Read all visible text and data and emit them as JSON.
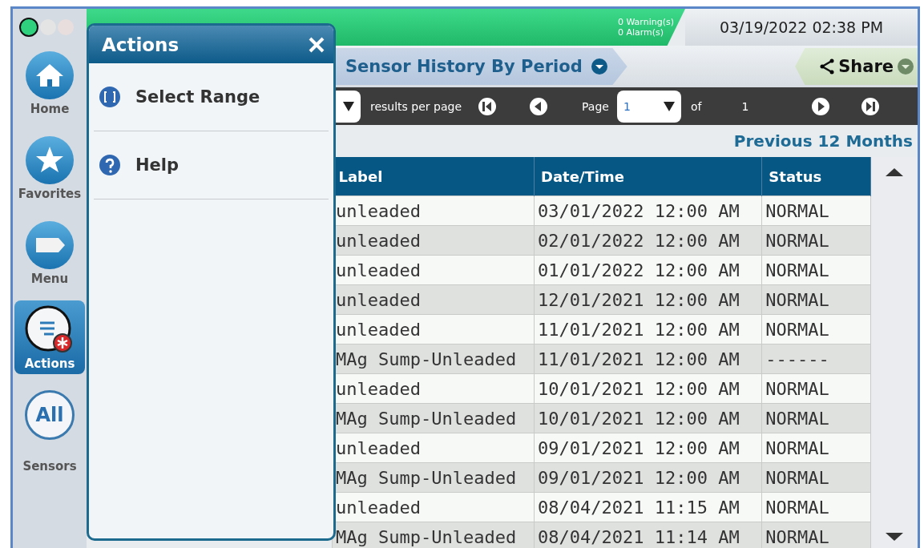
{
  "status_bar": {
    "warnings": "0 Warning(s)",
    "alarms": "0 Alarm(s)",
    "datetime": "03/19/2022 02:38 PM"
  },
  "sidebar": {
    "items": [
      {
        "label": "Home",
        "kind": "home",
        "selected": false
      },
      {
        "label": "Favorites",
        "kind": "star",
        "selected": false
      },
      {
        "label": "Menu",
        "kind": "menu",
        "selected": false
      },
      {
        "label": "Actions",
        "kind": "actions",
        "selected": true
      },
      {
        "label": "Sensors",
        "kind": "all",
        "icon_text": "All",
        "selected": false
      }
    ]
  },
  "actions_panel": {
    "title": "Actions",
    "items": [
      {
        "label": "Select Range",
        "kind": "range"
      },
      {
        "label": "Help",
        "kind": "help"
      }
    ]
  },
  "breadcrumb": {
    "title": "Sensor History By Period"
  },
  "share": {
    "label": "Share"
  },
  "pager": {
    "per_page_label": "results per page",
    "page_label": "Page",
    "page_value": "1",
    "of_label": "of",
    "total_pages": "1"
  },
  "period": "Previous 12 Months",
  "table": {
    "columns": [
      "Label",
      "Date/Time",
      "Status"
    ],
    "rows": [
      [
        "unleaded",
        "03/01/2022 12:00 AM",
        "NORMAL"
      ],
      [
        "unleaded",
        "02/01/2022 12:00 AM",
        "NORMAL"
      ],
      [
        "unleaded",
        "01/01/2022 12:00 AM",
        "NORMAL"
      ],
      [
        "unleaded",
        "12/01/2021 12:00 AM",
        "NORMAL"
      ],
      [
        "unleaded",
        "11/01/2021 12:00 AM",
        "NORMAL"
      ],
      [
        "MAg Sump-Unleaded",
        "11/01/2021 12:00 AM",
        "------"
      ],
      [
        "unleaded",
        "10/01/2021 12:00 AM",
        "NORMAL"
      ],
      [
        "MAg Sump-Unleaded",
        "10/01/2021 12:00 AM",
        "NORMAL"
      ],
      [
        "unleaded",
        "09/01/2021 12:00 AM",
        "NORMAL"
      ],
      [
        "MAg Sump-Unleaded",
        "09/01/2021 12:00 AM",
        "NORMAL"
      ],
      [
        "unleaded",
        "08/04/2021 11:15 AM",
        "NORMAL"
      ],
      [
        "MAg Sump-Unleaded",
        "08/04/2021 11:14 AM",
        "NORMAL"
      ]
    ]
  }
}
